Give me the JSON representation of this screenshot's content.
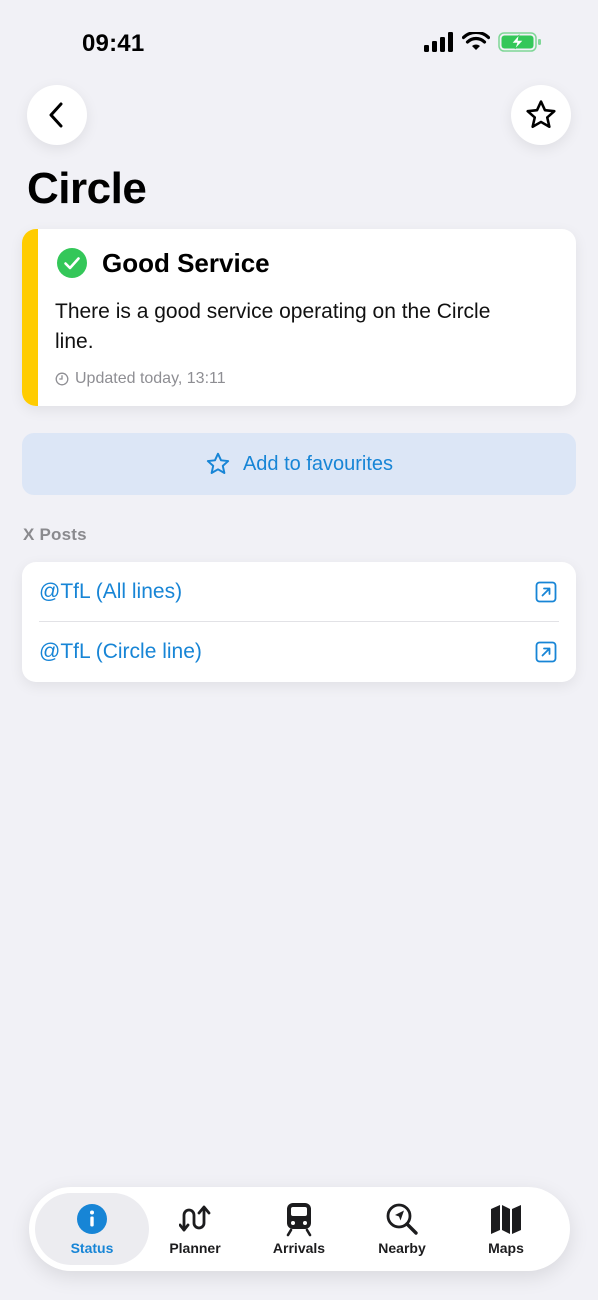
{
  "status_bar": {
    "time": "09:41",
    "icons": [
      "signal-icon",
      "wifi-icon",
      "battery-charging-icon"
    ]
  },
  "nav": {
    "back_icon": "chevron-left-icon",
    "favourite_icon": "star-outline-icon"
  },
  "page": {
    "title": "Circle",
    "line_color": "#FFCC00"
  },
  "status_card": {
    "icon": "checkmark-circle-icon",
    "heading": "Good Service",
    "description": "There is a good service operating on the Circle line.",
    "updated_icon": "clock-icon",
    "updated": "Updated today, 13:11"
  },
  "favourites_button": {
    "icon": "star-outline-icon",
    "label": "Add to favourites"
  },
  "x_posts": {
    "section_title": "X Posts",
    "links": [
      {
        "label": "@TfL (All lines)",
        "icon": "external-link-icon"
      },
      {
        "label": "@TfL (Circle line)",
        "icon": "external-link-icon"
      }
    ]
  },
  "tab_bar": {
    "tabs": [
      {
        "label": "Status",
        "icon": "info-icon",
        "active": true
      },
      {
        "label": "Planner",
        "icon": "route-icon",
        "active": false
      },
      {
        "label": "Arrivals",
        "icon": "train-icon",
        "active": false
      },
      {
        "label": "Nearby",
        "icon": "search-location-icon",
        "active": false
      },
      {
        "label": "Maps",
        "icon": "map-icon",
        "active": false
      }
    ]
  },
  "colors": {
    "accent": "#1785D6",
    "background": "#F1F1F6",
    "success": "#34C759",
    "line_circle": "#FFCC00"
  }
}
